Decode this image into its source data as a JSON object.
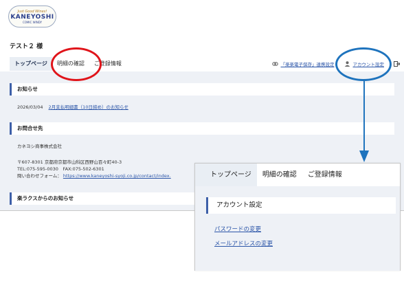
{
  "logo": {
    "line1": "Just Good Wines!",
    "line2": "KANEYOSHI",
    "line3": "COMIC WINDY"
  },
  "user": {
    "name": "テスト２ 様"
  },
  "tabs": [
    {
      "label": "トップページ",
      "active": true
    },
    {
      "label": "明細の確認",
      "active": false
    },
    {
      "label": "ご登録情報",
      "active": false
    }
  ],
  "top_links": {
    "storage_label": "「楽楽電子保存」連携設定",
    "account_label": "アカウント設定"
  },
  "notices": {
    "title": "お知らせ",
    "date": "2026/03/04",
    "link_text": "2月支払明細書（10日締め）のお知らせ"
  },
  "contact": {
    "title": "お問合せ先",
    "company": "カネヨシ商事株式会社",
    "address": "〒607-8301 京都府京都市山科区西野山百々町40-3",
    "phone": "TEL:075-595-0030　FAX:075-502-6301",
    "form_label": "問い合わせフォーム：",
    "form_url": "https://www.kaneyoshi-syoji.co.jp/contact/index."
  },
  "rakus": {
    "title": "楽ラクスからのお知らせ"
  },
  "zoom": {
    "tabs": [
      {
        "label": "トップページ",
        "active": true
      },
      {
        "label": "明細の確認",
        "active": false
      },
      {
        "label": "ご登録情報",
        "active": false
      }
    ],
    "section_title": "アカウント設定",
    "password_link": "パスワードの変更",
    "email_link": "メールアドレスの変更"
  },
  "colors": {
    "accent_blue": "#3d5fa8",
    "link": "#2b55a8",
    "highlight_red": "#e0141a",
    "highlight_blue": "#1e73bd",
    "content_bg": "#eef1f6"
  },
  "icons": [
    "link-icon",
    "user-icon",
    "logout-icon",
    "arrow-down-icon"
  ]
}
